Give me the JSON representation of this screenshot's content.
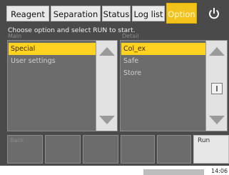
{
  "tabs": [
    {
      "label": "Reagent",
      "active": false
    },
    {
      "label": "Separation",
      "active": false
    },
    {
      "label": "Status",
      "active": false
    },
    {
      "label": "Log list",
      "active": false
    },
    {
      "label": "Option",
      "active": true
    }
  ],
  "instruction": "Choose option and select RUN to start.",
  "main": {
    "label": "Main",
    "items": [
      {
        "label": "Special",
        "selected": true
      },
      {
        "label": "User settings",
        "selected": false
      }
    ]
  },
  "detail": {
    "label": "Detail",
    "items": [
      {
        "label": "Col_ex",
        "selected": true
      },
      {
        "label": "Safe",
        "selected": false
      },
      {
        "label": "Store",
        "selected": false
      }
    ]
  },
  "bottom_buttons": {
    "first_label": "Back",
    "run_label": "Run"
  },
  "status": {
    "time": "14:06"
  },
  "colors": {
    "accent": "#f3c21b",
    "selection": "#ffd21f",
    "background": "#4a4a4a"
  },
  "icons": [
    "power-icon",
    "scroll-up-icon",
    "scroll-down-icon",
    "info-icon"
  ]
}
